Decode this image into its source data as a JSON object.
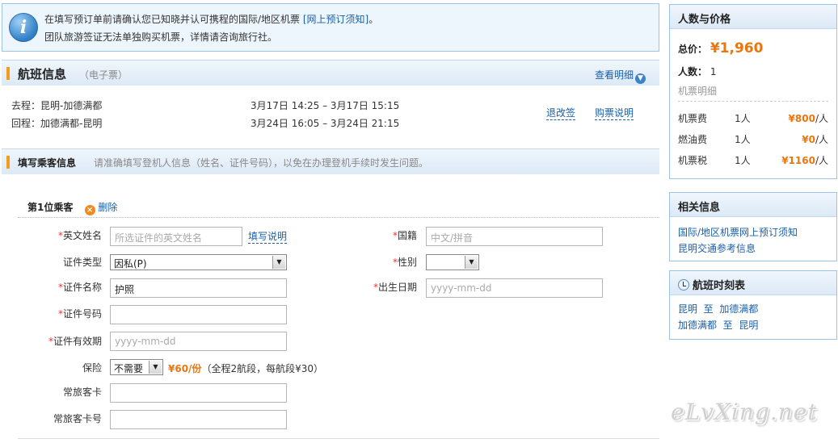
{
  "notice": {
    "line1_prefix": "在填写预订单前请确认您已知晓并认可携程的国际/地区机票",
    "line1_link": "[网上预订须知]",
    "line1_suffix": "。",
    "line2": "团队旅游签证无法单独购买机票，详情请咨询旅行社。"
  },
  "flight": {
    "title": "航班信息",
    "subtitle": "（电子票）",
    "detail_link": "查看明细",
    "outbound_label": "去程：昆明-加德满都",
    "outbound_time": "3月17日 14:25 – 3月17日 15:15",
    "return_label": "回程：加德满都-昆明",
    "return_time": "3月24日 16:05 – 3月24日 21:15",
    "refund_link": "退改签",
    "purchase_link": "购票说明"
  },
  "passenger_section": {
    "title": "填写乘客信息",
    "subtitle": "请准确填写登机人信息（姓名、证件号码），以免在办理登机手续时发生问题。"
  },
  "form": {
    "passenger_label": "第1位乘客",
    "delete_label": "删除",
    "required_mark": "*",
    "english_name_label": "英文姓名",
    "english_name_placeholder": "所选证件的英文姓名",
    "fill_guide_link": "填写说明",
    "nationality_label": "国籍",
    "nationality_placeholder": "中文/拼音",
    "id_type_label": "证件类型",
    "id_type_value": "因私(P)",
    "gender_label": "性别",
    "gender_value": "",
    "id_name_label": "证件名称",
    "id_name_value": "护照",
    "birth_label": "出生日期",
    "birth_placeholder": "yyyy-mm-dd",
    "id_number_label": "证件号码",
    "id_number_value": "",
    "id_expiry_label": "证件有效期",
    "id_expiry_placeholder": "yyyy-mm-dd",
    "insurance_label": "保险",
    "insurance_value": "不需要",
    "insurance_price": "¥60/份",
    "insurance_note": "（全程2航段，每航段¥30）",
    "ffp_card_label": "常旅客卡",
    "ffp_number_label": "常旅客卡号"
  },
  "price_panel": {
    "title": "人数与价格",
    "total_label": "总价：",
    "total_value": "¥1,960",
    "count_label": "人数：",
    "count_value": "1",
    "detail_label": "机票明细",
    "fees": [
      {
        "name": "机票费",
        "qty": "1人",
        "amount": "¥800",
        "unit": "/人"
      },
      {
        "name": "燃油费",
        "qty": "1人",
        "amount": "¥0",
        "unit": "/人"
      },
      {
        "name": "机票税",
        "qty": "1人",
        "amount": "¥1160",
        "unit": "/人"
      }
    ]
  },
  "related_panel": {
    "title": "相关信息",
    "links": [
      "国际/地区机票网上预订须知",
      "昆明交通参考信息"
    ]
  },
  "schedule_panel": {
    "title": "航班时刻表",
    "routes": [
      {
        "from": "昆明",
        "to_word": "至",
        "to": "加德满都"
      },
      {
        "from": "加德满都",
        "to_word": "至",
        "to": "昆明"
      }
    ]
  },
  "watermark": "eLvXing.net",
  "colors": {
    "accent": "#e9760f",
    "link": "#1a5fa8",
    "panel_border": "#9cc3e6"
  }
}
